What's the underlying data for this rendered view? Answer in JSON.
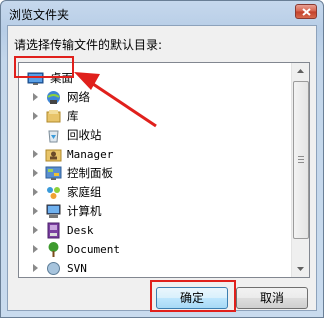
{
  "window": {
    "title": "浏览文件夹"
  },
  "prompt": "请选择传输文件的默认目录:",
  "tree": {
    "items": [
      {
        "label": "桌面",
        "icon": "desktop-icon",
        "level": 0,
        "expandable": false,
        "selected": true
      },
      {
        "label": "网络",
        "icon": "network-icon",
        "level": 1,
        "expandable": true
      },
      {
        "label": "库",
        "icon": "library-icon",
        "level": 1,
        "expandable": true
      },
      {
        "label": "回收站",
        "icon": "recycle-bin-icon",
        "level": 1,
        "expandable": false
      },
      {
        "label": "Manager",
        "icon": "user-folder-icon",
        "level": 1,
        "expandable": true
      },
      {
        "label": "控制面板",
        "icon": "control-panel-icon",
        "level": 1,
        "expandable": true
      },
      {
        "label": "家庭组",
        "icon": "homegroup-icon",
        "level": 1,
        "expandable": true
      },
      {
        "label": "计算机",
        "icon": "computer-icon",
        "level": 1,
        "expandable": true
      },
      {
        "label": "Desk",
        "icon": "drive-icon",
        "level": 1,
        "expandable": true
      },
      {
        "label": "Document",
        "icon": "tree-icon",
        "level": 1,
        "expandable": true
      },
      {
        "label": "SVN",
        "icon": "svn-icon",
        "level": 1,
        "expandable": true
      }
    ]
  },
  "buttons": {
    "ok": "确定",
    "cancel": "取消"
  },
  "colors": {
    "annotation": "#e0201c",
    "selection_border": "#e0201c"
  }
}
